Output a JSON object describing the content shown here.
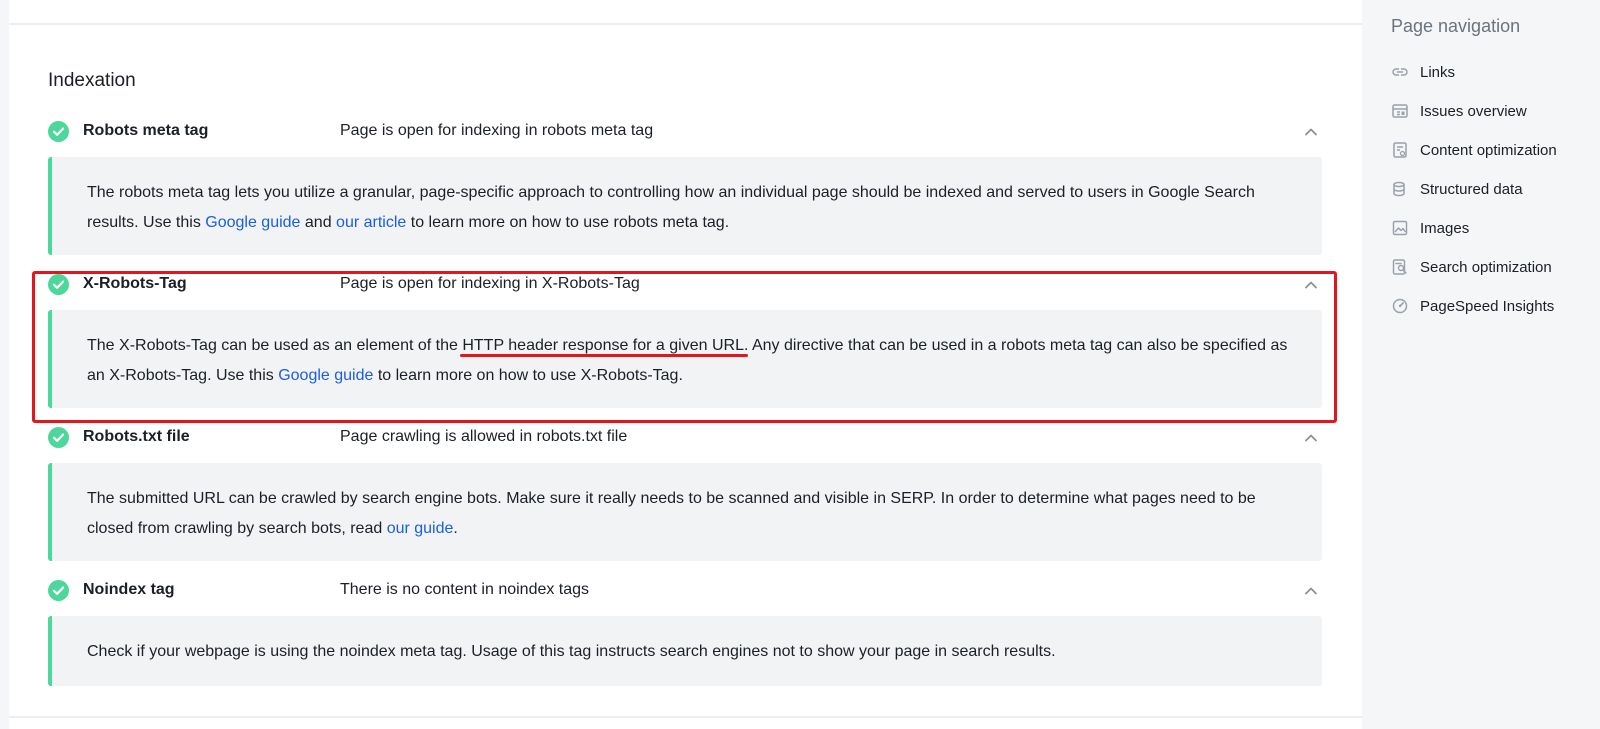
{
  "section": {
    "title": "Indexation"
  },
  "checks": [
    {
      "name": "Robots meta tag",
      "status": "Page is open for indexing in robots meta tag",
      "body": {
        "t1": "The robots meta tag lets you utilize a granular, page-specific approach to controlling how an individual page should be indexed and served to users in Google Search results. Use this ",
        "link1": "Google guide",
        "t2": " and ",
        "link2": "our article",
        "t3": " to learn more on how to use robots meta tag."
      }
    },
    {
      "name": "X-Robots-Tag",
      "status": "Page is open for indexing in X-Robots-Tag",
      "body": {
        "t1": "The X-Robots-Tag can be used as an element of the ",
        "underlined": "HTTP header response for a given URL",
        "t2": ". Any directive that can be used in a robots meta tag can also be specified as an X-Robots-Tag. Use this ",
        "link1": "Google guide",
        "t3": " to learn more on how to use X-Robots-Tag."
      }
    },
    {
      "name": "Robots.txt file",
      "status": "Page crawling is allowed in robots.txt file",
      "body": {
        "t1": "The submitted URL can be crawled by search engine bots. Make sure it really needs to be scanned and visible in SERP. In order to determine what pages need to be closed from crawling by search bots, read ",
        "link1": "our guide",
        "t2": "."
      }
    },
    {
      "name": "Noindex tag",
      "status": "There is no content in noindex tags",
      "body": {
        "t1": "Check if your webpage is using the noindex meta tag. Usage of this tag instructs search engines not to show your page in search results."
      }
    }
  ],
  "sidebar": {
    "title": "Page navigation",
    "items": [
      {
        "label": "Links",
        "icon": "link-icon"
      },
      {
        "label": "Issues overview",
        "icon": "issues-overview-icon"
      },
      {
        "label": "Content optimization",
        "icon": "content-optimization-icon"
      },
      {
        "label": "Structured data",
        "icon": "database-icon"
      },
      {
        "label": "Images",
        "icon": "image-icon"
      },
      {
        "label": "Search optimization",
        "icon": "search-document-icon"
      },
      {
        "label": "PageSpeed Insights",
        "icon": "speedometer-icon"
      }
    ]
  },
  "colors": {
    "success": "#4dd79b",
    "link": "#1a5de6",
    "highlight": "#e3161e",
    "card_bg": "#f2f3f5"
  }
}
